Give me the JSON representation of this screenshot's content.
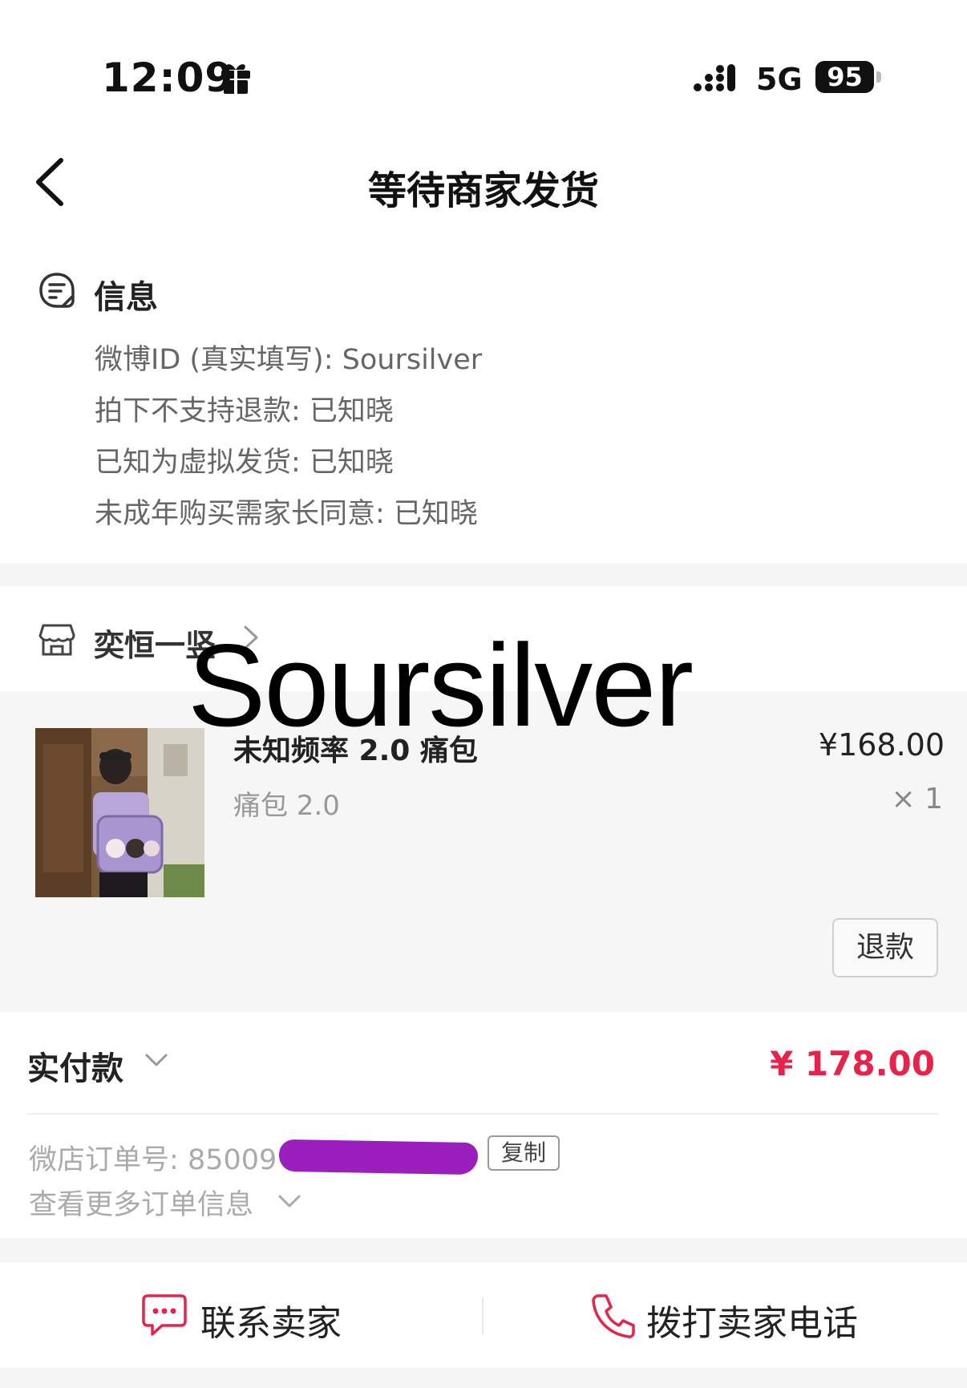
{
  "status_bar": {
    "time": "12:09",
    "network": "5G",
    "battery": "95"
  },
  "nav": {
    "title": "等待商家发货"
  },
  "info": {
    "title": "信息",
    "lines": [
      "微博ID (真实填写): Soursilver",
      "拍下不支持退款: 已知晓",
      "已知为虚拟发货: 已知晓",
      "未成年购买需家长同意: 已知晓"
    ]
  },
  "shop": {
    "name": "奕恒一竖"
  },
  "watermark": "Soursilver",
  "product": {
    "name": "未知频率 2.0 痛包",
    "spec": "痛包 2.0",
    "price": "¥168.00",
    "quantity": "× 1",
    "refund_label": "退款"
  },
  "payment": {
    "label": "实付款",
    "amount": "¥ 178.00",
    "order_label": "微店订单号:",
    "order_number_visible": "85009",
    "copy_label": "复制",
    "more_info_label": "查看更多订单信息"
  },
  "actions": {
    "contact_label": "联系卖家",
    "call_label": "拨打卖家电话"
  },
  "colors": {
    "accent_price": "#e8234a",
    "icon_red": "#e8234a",
    "redaction": "#9b1fbd"
  },
  "icons": [
    "gift-icon",
    "signal-icon",
    "back-icon",
    "info-doc-icon",
    "shop-icon",
    "chevron-right-icon",
    "chevron-down-icon",
    "chat-icon",
    "phone-icon"
  ]
}
